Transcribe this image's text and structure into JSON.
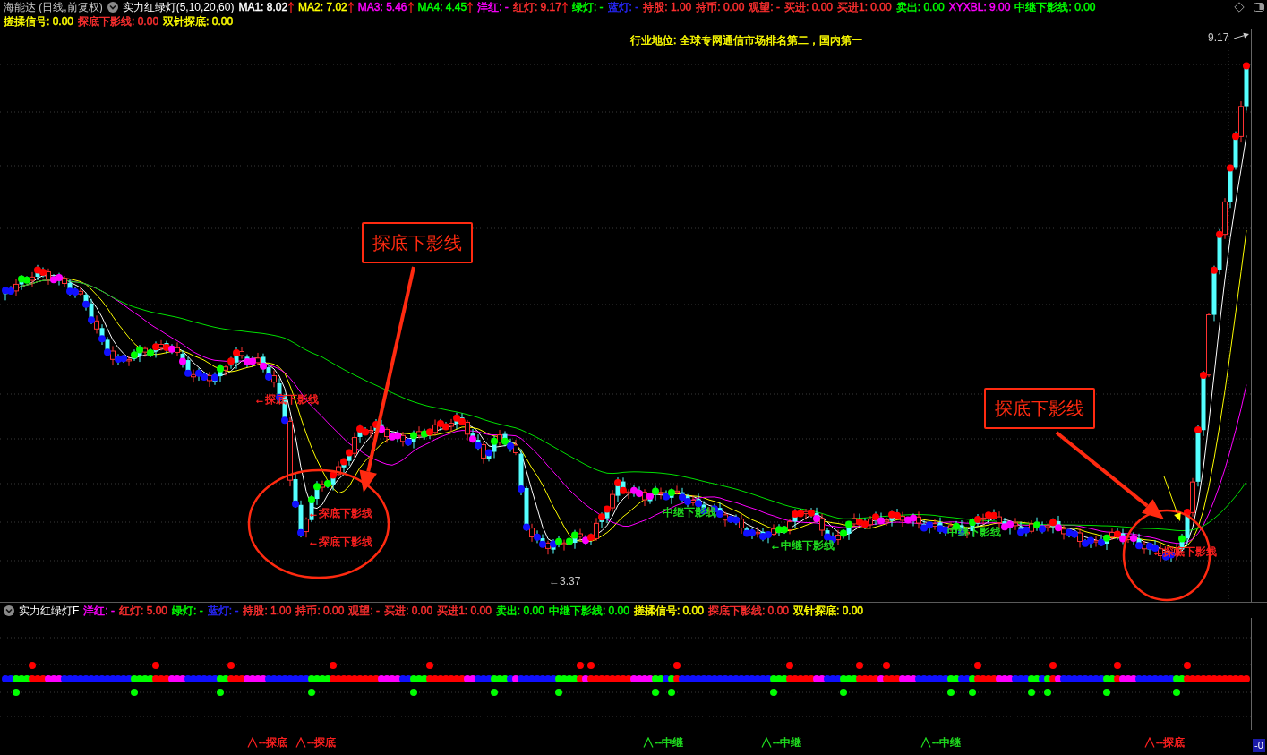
{
  "header": {
    "stock": "海能达 (日线,前复权)",
    "indicator": "实力红绿灯(5,10,20,60)",
    "legend": [
      {
        "text": "MA1: 8.02",
        "color": "#ffffff",
        "up_arrow": true
      },
      {
        "text": "MA2: 7.02",
        "color": "#ffff00",
        "up_arrow": true
      },
      {
        "text": "MA3: 5.46",
        "color": "#ff00ff",
        "up_arrow": true
      },
      {
        "text": "MA4: 4.45",
        "color": "#00ff00",
        "up_arrow": true
      },
      {
        "text": "洋红: -",
        "color": "#ff00ff",
        "up_arrow": false
      },
      {
        "text": "红灯: 9.17",
        "color": "#ff3030",
        "up_arrow": true
      },
      {
        "text": "绿灯: -",
        "color": "#00ff00",
        "up_arrow": false
      },
      {
        "text": "蓝灯: -",
        "color": "#2828ff",
        "up_arrow": false
      },
      {
        "text": "持股: 1.00",
        "color": "#ff3030",
        "up_arrow": false
      },
      {
        "text": "持币: 0.00",
        "color": "#ff3030",
        "up_arrow": false
      },
      {
        "text": "观望: -",
        "color": "#ff3030",
        "up_arrow": false
      },
      {
        "text": "买进: 0.00",
        "color": "#ff3030",
        "up_arrow": false
      },
      {
        "text": "买进1: 0.00",
        "color": "#ff3030",
        "up_arrow": false
      },
      {
        "text": "卖出: 0.00",
        "color": "#00ff00",
        "up_arrow": false
      },
      {
        "text": "XYXBL: 9.00",
        "color": "#ff00ff",
        "up_arrow": false
      },
      {
        "text": "中继下影线: 0.00",
        "color": "#00ff00",
        "up_arrow": false
      }
    ],
    "legend_line2": [
      {
        "text": "搓揉信号: 0.00",
        "color": "#ffff00"
      },
      {
        "text": "探底下影线: 0.00",
        "color": "#ff3030"
      },
      {
        "text": "双针探底: 0.00",
        "color": "#ffff00"
      }
    ]
  },
  "chart": {
    "note": "行业地位: 全球专网通信市场排名第二，国内第一",
    "high_label": "9.17",
    "low_label": "←3.37",
    "callouts": [
      "探底下影线",
      "探底下影线"
    ],
    "signal_labels": [
      {
        "text": "←探底下影线",
        "color": "#ff2020"
      },
      {
        "text": "←探底下影线",
        "color": "#ff2020"
      },
      {
        "text": "←探底下影线",
        "color": "#ff2020"
      },
      {
        "text": "中继下影线",
        "color": "#20e020"
      },
      {
        "text": "←中继下影线",
        "color": "#20e020"
      },
      {
        "text": "中继下影线",
        "color": "#20e020"
      },
      {
        "text": "←探底下影线",
        "color": "#ff2020"
      }
    ]
  },
  "lower_panel": {
    "indicator": "实力红绿灯F",
    "legend": [
      {
        "text": "洋红: -",
        "color": "#ff00ff"
      },
      {
        "text": "红灯: 5.00",
        "color": "#ff3030"
      },
      {
        "text": "绿灯: -",
        "color": "#00ff00"
      },
      {
        "text": "蓝灯: -",
        "color": "#2828ff"
      },
      {
        "text": "持股: 1.00",
        "color": "#ff3030"
      },
      {
        "text": "持币: 0.00",
        "color": "#ff3030"
      },
      {
        "text": "观望: -",
        "color": "#ff3030"
      },
      {
        "text": "买进: 0.00",
        "color": "#ff3030"
      },
      {
        "text": "买进1: 0.00",
        "color": "#ff3030"
      },
      {
        "text": "卖出: 0.00",
        "color": "#00ff00"
      },
      {
        "text": "中继下影线: 0.00",
        "color": "#00ff00"
      },
      {
        "text": "搓揉信号: 0.00",
        "color": "#ffff00"
      },
      {
        "text": "探底下影线: 0.00",
        "color": "#ff3030"
      },
      {
        "text": "双针探底: 0.00",
        "color": "#ffff00"
      }
    ]
  },
  "signal_marks": [
    {
      "text": "--探底",
      "color": "#ff2020"
    },
    {
      "text": "--探底",
      "color": "#ff2020"
    },
    {
      "text": "--中继",
      "color": "#20e020"
    },
    {
      "text": "--中继",
      "color": "#20e020"
    },
    {
      "text": "--中继",
      "color": "#20e020"
    },
    {
      "text": "--探底",
      "color": "#ff2020"
    }
  ],
  "axis_label": "-0"
}
